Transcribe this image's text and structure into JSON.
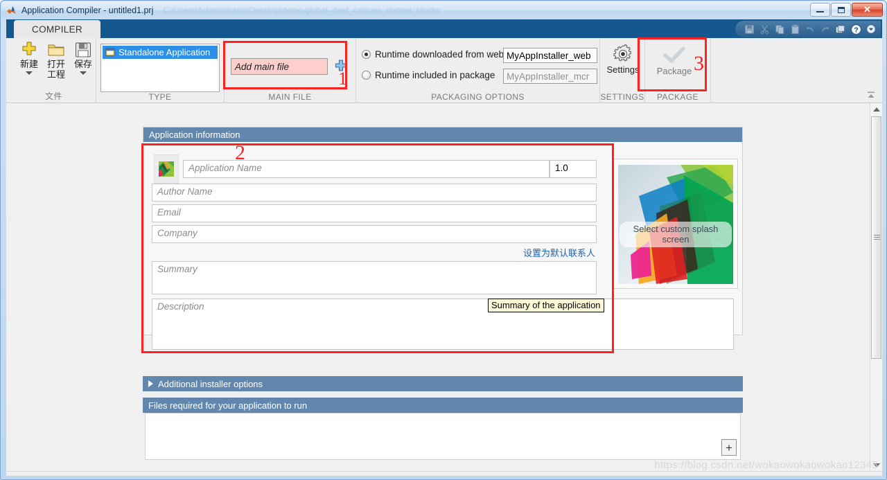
{
  "window": {
    "title": "Application Compiler - untitled1.prj",
    "title_icon": "matlab-logo-icon",
    "blurred_path": "C:\\Users\\Administrator\\Desktop\\demo-global_daef_calques_dodaet_blocks",
    "buttons": {
      "minimize": "minimize-button",
      "maximize": "maximize-button",
      "close": "✕"
    }
  },
  "ribbon": {
    "tab": "COMPILER",
    "quick_access": [
      {
        "name": "save-icon",
        "glyph": "💾",
        "enabled": false
      },
      {
        "name": "cut-icon",
        "glyph": "✂",
        "enabled": false
      },
      {
        "name": "copy-icon",
        "glyph": "⧉",
        "enabled": false
      },
      {
        "name": "paste-icon",
        "glyph": "📋",
        "enabled": false
      },
      {
        "name": "undo-icon",
        "glyph": "↶",
        "enabled": false
      },
      {
        "name": "redo-icon",
        "glyph": "↷",
        "enabled": false
      },
      {
        "name": "layout-icon",
        "glyph": "❐",
        "enabled": true
      },
      {
        "name": "help-icon",
        "glyph": "?",
        "enabled": true
      },
      {
        "name": "dropdown-icon",
        "glyph": "▼",
        "enabled": true
      }
    ],
    "groups": [
      {
        "name": "file",
        "label": "文件",
        "buttons": [
          {
            "name": "new-button",
            "label": "新建",
            "icon": "plus-icon",
            "has_caret": true
          },
          {
            "name": "open-button",
            "label": "打开",
            "label2": "工程",
            "icon": "folder-icon",
            "has_caret": false
          },
          {
            "name": "save-button",
            "label": "保存",
            "icon": "floppy-icon",
            "has_caret": true
          }
        ]
      },
      {
        "name": "type",
        "label": "TYPE",
        "selected_item": "Standalone Application",
        "item_icon": "application-window-icon"
      },
      {
        "name": "main-file",
        "label": "MAIN FILE",
        "input_placeholder": "Add main file",
        "add_icon": "plus-icon"
      },
      {
        "name": "packaging-options",
        "label": "PACKAGING OPTIONS",
        "options": [
          {
            "label": "Runtime downloaded from web",
            "checked": true,
            "value": "MyAppInstaller_web",
            "enabled": true
          },
          {
            "label": "Runtime included in package",
            "checked": false,
            "value": "MyAppInstaller_mcr",
            "enabled": false
          }
        ]
      },
      {
        "name": "settings",
        "label": "SETTINGS",
        "button": {
          "label": "Settings",
          "icon": "gear-icon"
        }
      },
      {
        "name": "package",
        "label": "PACKAGE",
        "button": {
          "label": "Package",
          "icon": "checkmark-icon",
          "enabled": false
        }
      }
    ],
    "collapse_icon": "collapse-ribbon-icon"
  },
  "main": {
    "app_info": {
      "header": "Application information",
      "app_icon": "matlab-app-icon",
      "fields": {
        "app_name": {
          "placeholder": "Application Name",
          "value": ""
        },
        "version": {
          "value": "1.0"
        },
        "author": {
          "placeholder": "Author Name",
          "value": ""
        },
        "email": {
          "placeholder": "Email",
          "value": ""
        },
        "company": {
          "placeholder": "Company",
          "value": ""
        },
        "summary": {
          "placeholder": "Summary",
          "value": ""
        },
        "description": {
          "placeholder": "Description",
          "value": ""
        }
      },
      "default_contact_link": "设置为默认联系人",
      "tooltip": "Summary of the application",
      "splash": {
        "label": "Select custom splash screen"
      }
    },
    "installer_bar": {
      "label": "Additional installer options",
      "expand_icon": "triangle-right-icon"
    },
    "files_bar": {
      "label": "Files required for your application to run"
    },
    "files_add_button": "+"
  },
  "scrollbar": {
    "up_icon": "arrow-up-icon",
    "down_icon": "arrow-down-icon",
    "grip_icon": "scrollbar-grip-icon"
  },
  "annotations": [
    {
      "id": "1",
      "label": "1",
      "target": "main-file-group"
    },
    {
      "id": "2",
      "label": "2",
      "target": "application-information-panel"
    },
    {
      "id": "3",
      "label": "3",
      "target": "package-group"
    }
  ],
  "watermark": "https://blog.csdn.net/wokaowokaowokao12345",
  "colors": {
    "titlebar_blue": "#14588f",
    "panel_header": "#6287ae",
    "selection_blue": "#2d8fe8",
    "annotation_red": "#ff2020",
    "link_blue": "#1b63b5",
    "pink_field": "#fccfcd"
  }
}
